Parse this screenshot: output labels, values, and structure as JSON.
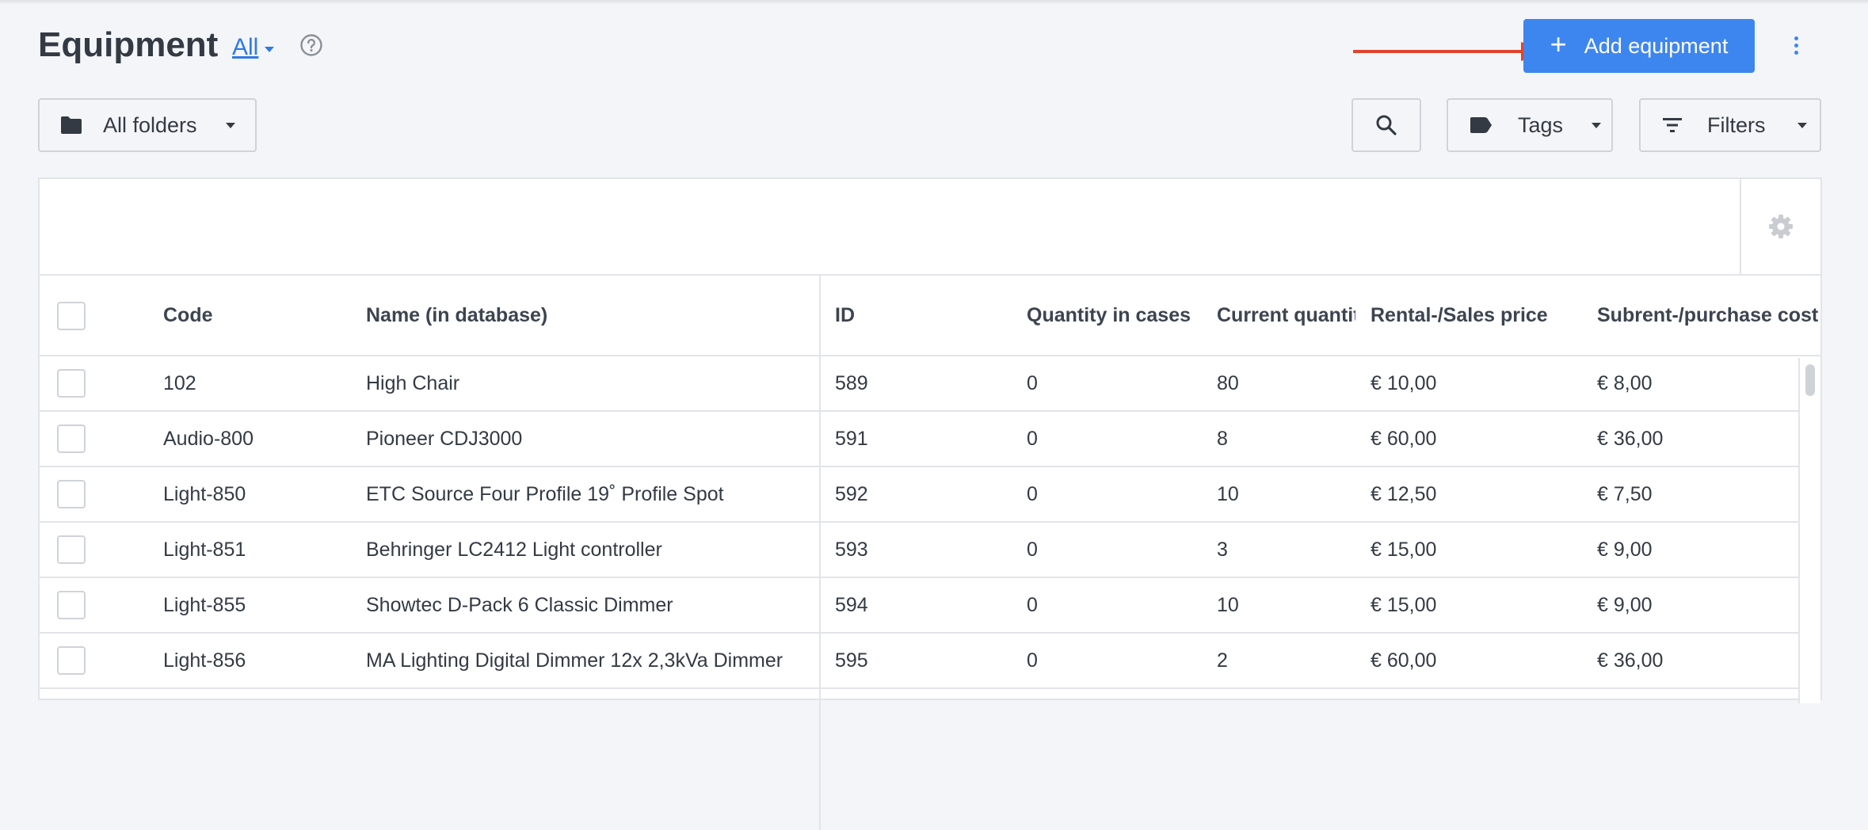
{
  "header": {
    "title": "Equipment",
    "view_filter": "All",
    "add_button_label": "Add equipment"
  },
  "toolbar": {
    "folders_label": "All folders",
    "tags_label": "Tags",
    "filters_label": "Filters"
  },
  "colors": {
    "accent": "#3d86f0",
    "annotation_arrow": "#e0442c"
  },
  "table": {
    "columns": [
      "Code",
      "Name (in database)",
      "ID",
      "Quantity in cases",
      "Current quantit",
      "Rental-/Sales price",
      "Subrent-/purchase cost"
    ],
    "rows": [
      {
        "code": "102",
        "name": "High Chair",
        "id": "589",
        "qty_in_cases": "0",
        "current_qty": "80",
        "rental_price": "€ 10,00",
        "purchase_cost": "€ 8,00"
      },
      {
        "code": "Audio-800",
        "name": "Pioneer CDJ3000",
        "id": "591",
        "qty_in_cases": "0",
        "current_qty": "8",
        "rental_price": "€ 60,00",
        "purchase_cost": "€ 36,00"
      },
      {
        "code": "Light-850",
        "name": "ETC Source Four Profile 19˚ Profile Spot",
        "id": "592",
        "qty_in_cases": "0",
        "current_qty": "10",
        "rental_price": "€ 12,50",
        "purchase_cost": "€ 7,50"
      },
      {
        "code": "Light-851",
        "name": "Behringer LC2412 Light controller",
        "id": "593",
        "qty_in_cases": "0",
        "current_qty": "3",
        "rental_price": "€ 15,00",
        "purchase_cost": "€ 9,00"
      },
      {
        "code": "Light-855",
        "name": "Showtec D-Pack 6 Classic Dimmer",
        "id": "594",
        "qty_in_cases": "0",
        "current_qty": "10",
        "rental_price": "€ 15,00",
        "purchase_cost": "€ 9,00"
      },
      {
        "code": "Light-856",
        "name": "MA Lighting Digital Dimmer 12x 2,3kVa Dimmer",
        "id": "595",
        "qty_in_cases": "0",
        "current_qty": "2",
        "rental_price": "€ 60,00",
        "purchase_cost": "€ 36,00"
      }
    ]
  }
}
